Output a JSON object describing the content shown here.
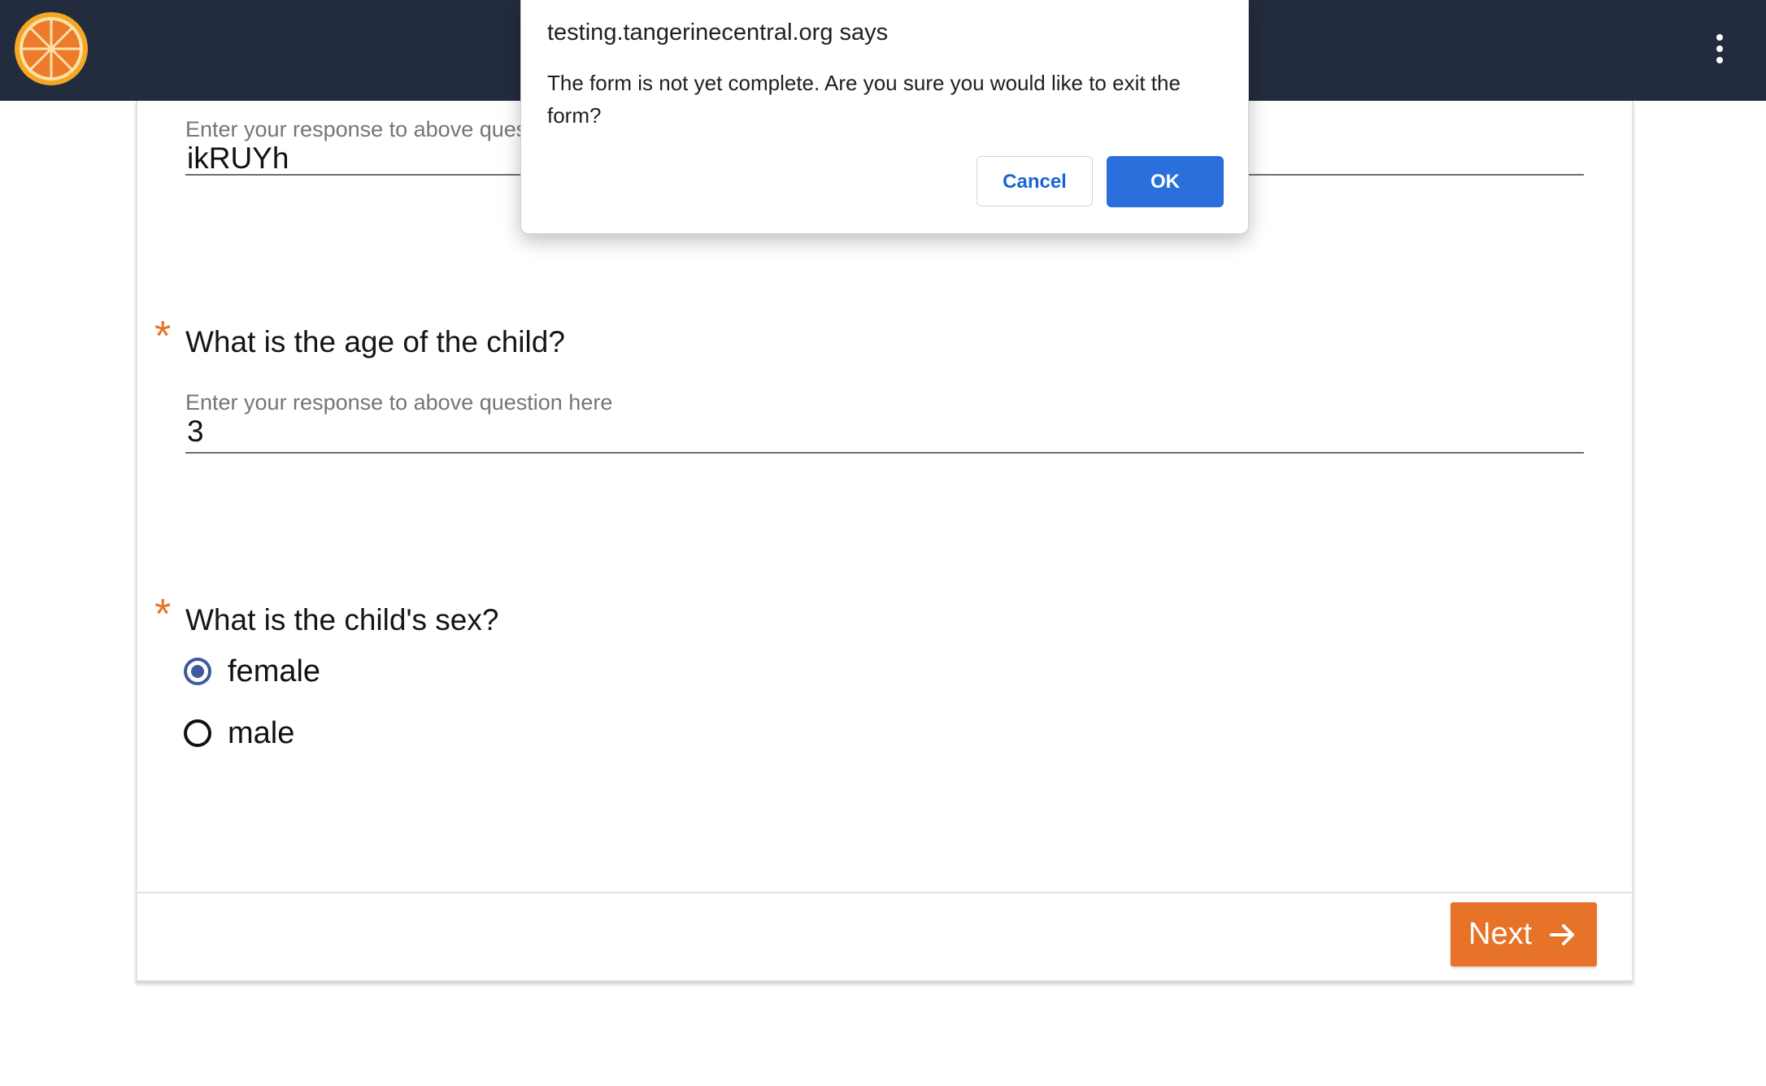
{
  "header": {
    "logo_icon": "tangerine-slice-logo",
    "menu_icon": "vertical-dots-icon",
    "background_color": "#232b3e"
  },
  "form": {
    "questions": [
      {
        "question": "",
        "placeholder": "Enter your response to above question here",
        "value": "ikRUYh"
      },
      {
        "required": true,
        "question": "What is the age of the child?",
        "placeholder": "Enter your response to above question here",
        "value": "3"
      },
      {
        "required": true,
        "question": "What is the child's sex?",
        "options": [
          {
            "label": "female",
            "checked": true
          },
          {
            "label": "male",
            "checked": false
          }
        ]
      }
    ],
    "required_marker": "*",
    "next_label": "Next",
    "accent_color": "#e67328"
  },
  "dialog": {
    "title": "testing.tangerinecentral.org says",
    "message": "The form is not yet complete. Are you sure you would like to exit the form?",
    "cancel_label": "Cancel",
    "ok_label": "OK",
    "ok_color": "#2b6fdd"
  }
}
